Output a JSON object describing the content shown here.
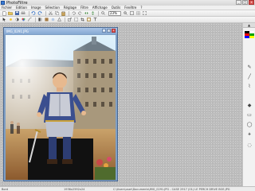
{
  "app": {
    "title": "PhotoFiltre",
    "controls": {
      "minimize": "_",
      "maximize": "□",
      "close": "x"
    }
  },
  "menu": {
    "items": [
      "Fichier",
      "Edition",
      "Image",
      "Sélection",
      "Réglage",
      "Filtre",
      "Affichage",
      "Outils",
      "Fenêtre",
      "?"
    ]
  },
  "toolbar": {
    "zoom_value": "23%"
  },
  "document": {
    "title": "IMG_0291.JPG",
    "controls": {
      "minimize": "_",
      "maximize": "□",
      "close": "x"
    }
  },
  "palette": {
    "header": "▲",
    "swatch_colors": [
      "#000000",
      "#ffffff",
      "#ff0000",
      "#00a000",
      "#0000ff",
      "#ffff00",
      "#ff00ff",
      "#00ffff",
      "#808080",
      "#c0c0c0",
      "#800000",
      "#008080"
    ],
    "tools": [
      "pencil",
      "line",
      "brush",
      "bucket",
      "shape",
      "text"
    ]
  },
  "status": {
    "position": "Bord",
    "size": "1936x2592x24",
    "path": "C:\\Users\\user\\Documents\\IMG_0291.JPG - CASE 2917 (01) LE PERCH DRIVE BOE.JPG"
  },
  "colors": {
    "workspace": "#bdbdbd",
    "doc_titlebar": "#a9c4e6",
    "sky": "#9fcbe8",
    "building": "#b9a98f"
  }
}
